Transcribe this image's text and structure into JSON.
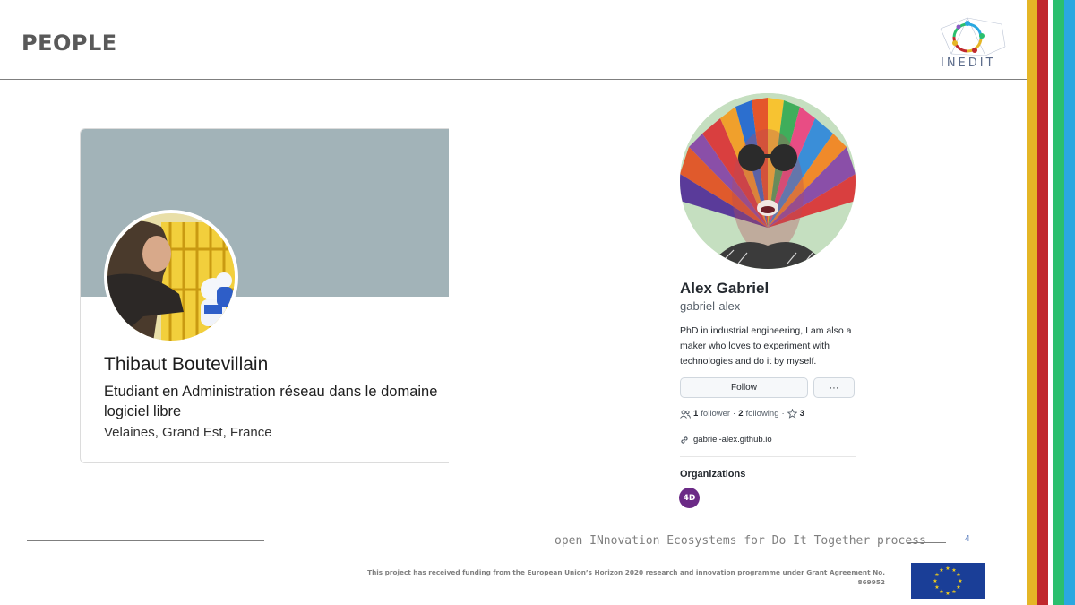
{
  "slide": {
    "title": "PEOPLE",
    "logo_text": "INEDIT",
    "page_number": "4",
    "tagline": "open INnovation Ecosystems for Do It Together process",
    "funding_line1": "This project has received funding from the European Union’s Horizon 2020 research and innovation programme under Grant Agreement No.",
    "funding_line2": "869952"
  },
  "colors": {
    "stripes": [
      "#e5b626",
      "#c0282d",
      "#2bbf6e",
      "#2aa8e0"
    ],
    "linkedin_cover": "#a2b3b8",
    "org_badge": "#6b2a86",
    "eu_flag": "#1a3e97"
  },
  "linkedin_card": {
    "name": "Thibaut Boutevillain",
    "headline": "Etudiant en Administration réseau dans le domaine logiciel libre",
    "location": "Velaines, Grand Est, France"
  },
  "github_profile": {
    "name": "Alex Gabriel",
    "login": "gabriel-alex",
    "bio": "PhD in industrial engineering, I am also a maker who loves to experiment with technologies and do it by myself.",
    "follow_label": "Follow",
    "more_label": "···",
    "followers_count": "1",
    "followers_label": "follower",
    "following_count": "2",
    "following_label": "following",
    "stars_count": "3",
    "separator": "·",
    "website": "gabriel-alex.github.io",
    "organizations_heading": "Organizations",
    "org_badge_text": "4D"
  },
  "icons": {
    "people": "people-icon",
    "star": "star-icon",
    "link": "link-icon"
  }
}
